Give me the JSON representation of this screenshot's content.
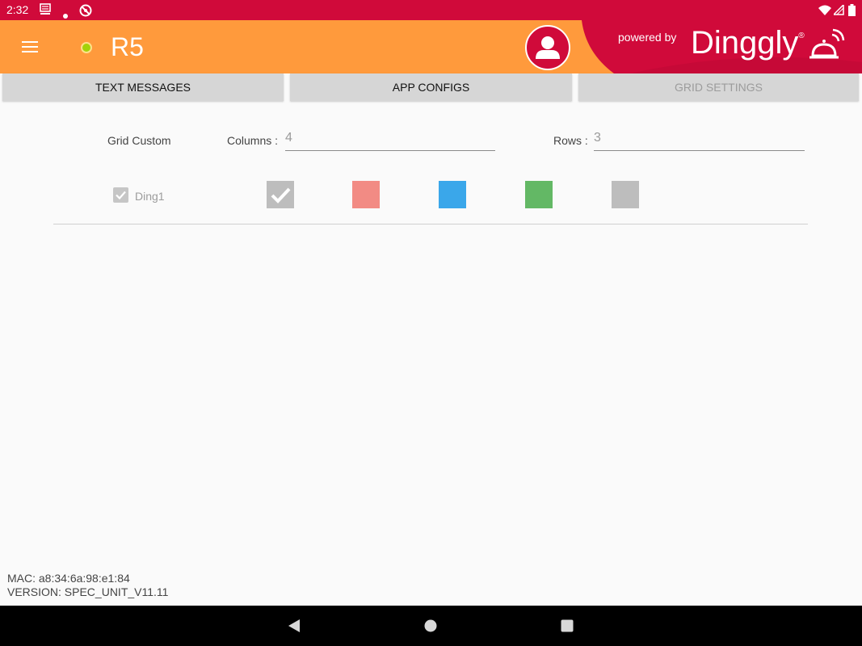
{
  "status_bar": {
    "time": "2:32",
    "icons_left": [
      "server-icon",
      "dot-icon",
      "blocked-icon"
    ],
    "icons_right": [
      "wifi-icon",
      "signal-icon",
      "battery-icon"
    ]
  },
  "app_bar": {
    "title": "R5",
    "status_dot_color": "#a4d20a",
    "powered_by": "powered by",
    "brand": "Dinggly",
    "brand_mark": "®"
  },
  "tabs": [
    {
      "label": "TEXT MESSAGES",
      "enabled": true
    },
    {
      "label": "APP CONFIGS",
      "enabled": true
    },
    {
      "label": "GRID SETTINGS",
      "enabled": false
    }
  ],
  "grid": {
    "section_label": "Grid Custom",
    "columns_label": "Columns :",
    "columns_value": "4",
    "rows_label": "Rows :",
    "rows_value": "3"
  },
  "ding": {
    "label": "Ding1",
    "checked": true
  },
  "swatches": [
    {
      "color": "#bdbdbd",
      "selected": true
    },
    {
      "color": "#f28b84",
      "selected": false
    },
    {
      "color": "#3aa7ea",
      "selected": false
    },
    {
      "color": "#63b865",
      "selected": false
    },
    {
      "color": "#bdbdbd",
      "selected": false
    }
  ],
  "footer": {
    "mac": "MAC: a8:34:6a:98:e1:84",
    "version": "VERSION: SPEC_UNIT_V11.11"
  },
  "colors": {
    "status_bar": "#d00a3a",
    "app_bar": "#ff9a3c",
    "brand_red": "#d00a3a",
    "tab_bg": "#d6d6d6"
  }
}
